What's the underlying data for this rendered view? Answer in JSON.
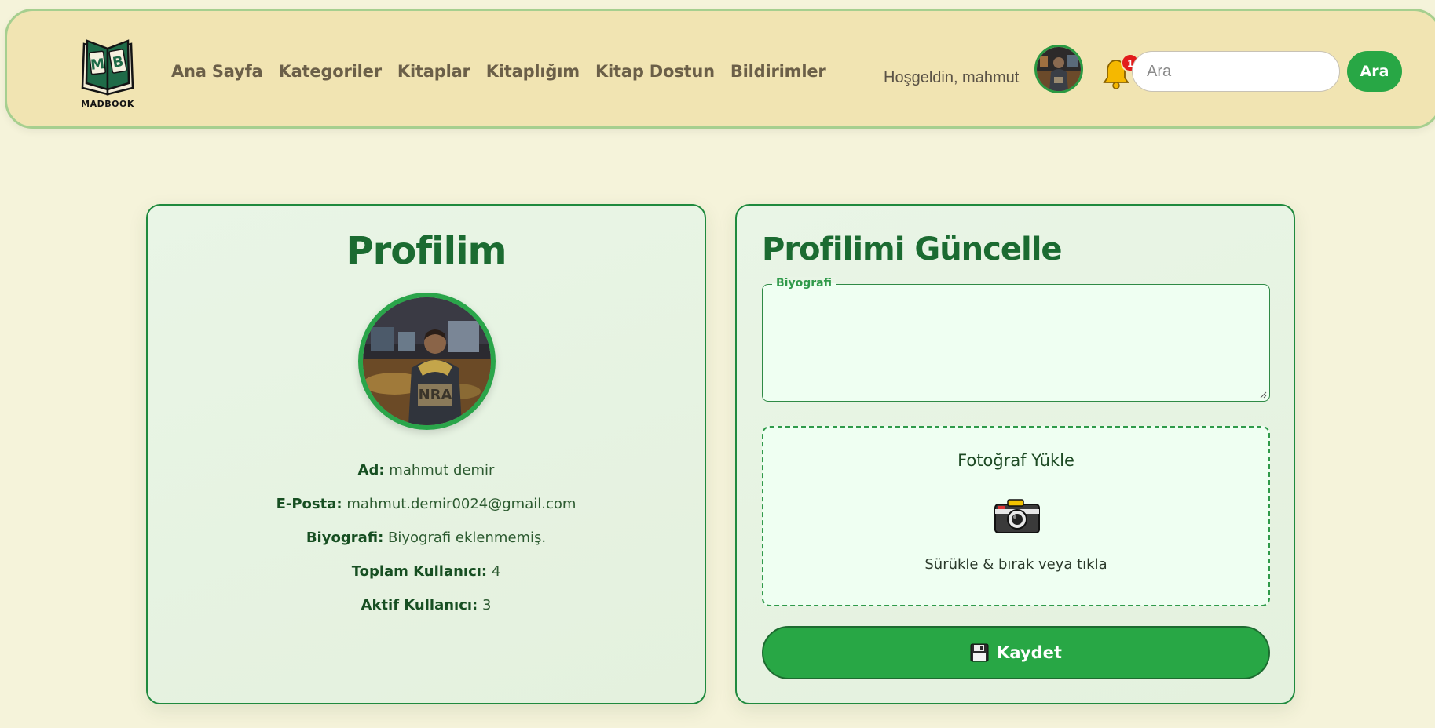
{
  "navbar": {
    "logo_text": "MADBOOK",
    "links": [
      "Ana Sayfa",
      "Kategoriler",
      "Kitaplar",
      "Kitaplığım",
      "Kitap Dostun",
      "Bildirimler"
    ],
    "welcome": "Hoşgeldin, mahmut",
    "notification_count": "1",
    "search_placeholder": "Ara",
    "search_button": "Ara"
  },
  "profile": {
    "title": "Profilim",
    "fields": [
      {
        "label": "Ad:",
        "value": "mahmut demir"
      },
      {
        "label": "E-Posta:",
        "value": "mahmut.demir0024@gmail.com"
      },
      {
        "label": "Biyografi:",
        "value": "Biyografi eklenmemiş."
      },
      {
        "label": "Toplam Kullanıcı:",
        "value": "4"
      },
      {
        "label": "Aktif Kullanıcı:",
        "value": "3"
      }
    ]
  },
  "update": {
    "title": "Profilimi Güncelle",
    "bio_legend": "Biyografi",
    "bio_value": "",
    "upload_title": "Fotoğraf Yükle",
    "upload_hint": "Sürükle & bırak veya tıkla",
    "save_label": "Kaydet"
  },
  "colors": {
    "accent": "#28a745",
    "heading": "#1b6b31",
    "navbar_bg": "#f1e4b2",
    "page_bg": "#f5f3da",
    "badge": "#e21b1b"
  }
}
